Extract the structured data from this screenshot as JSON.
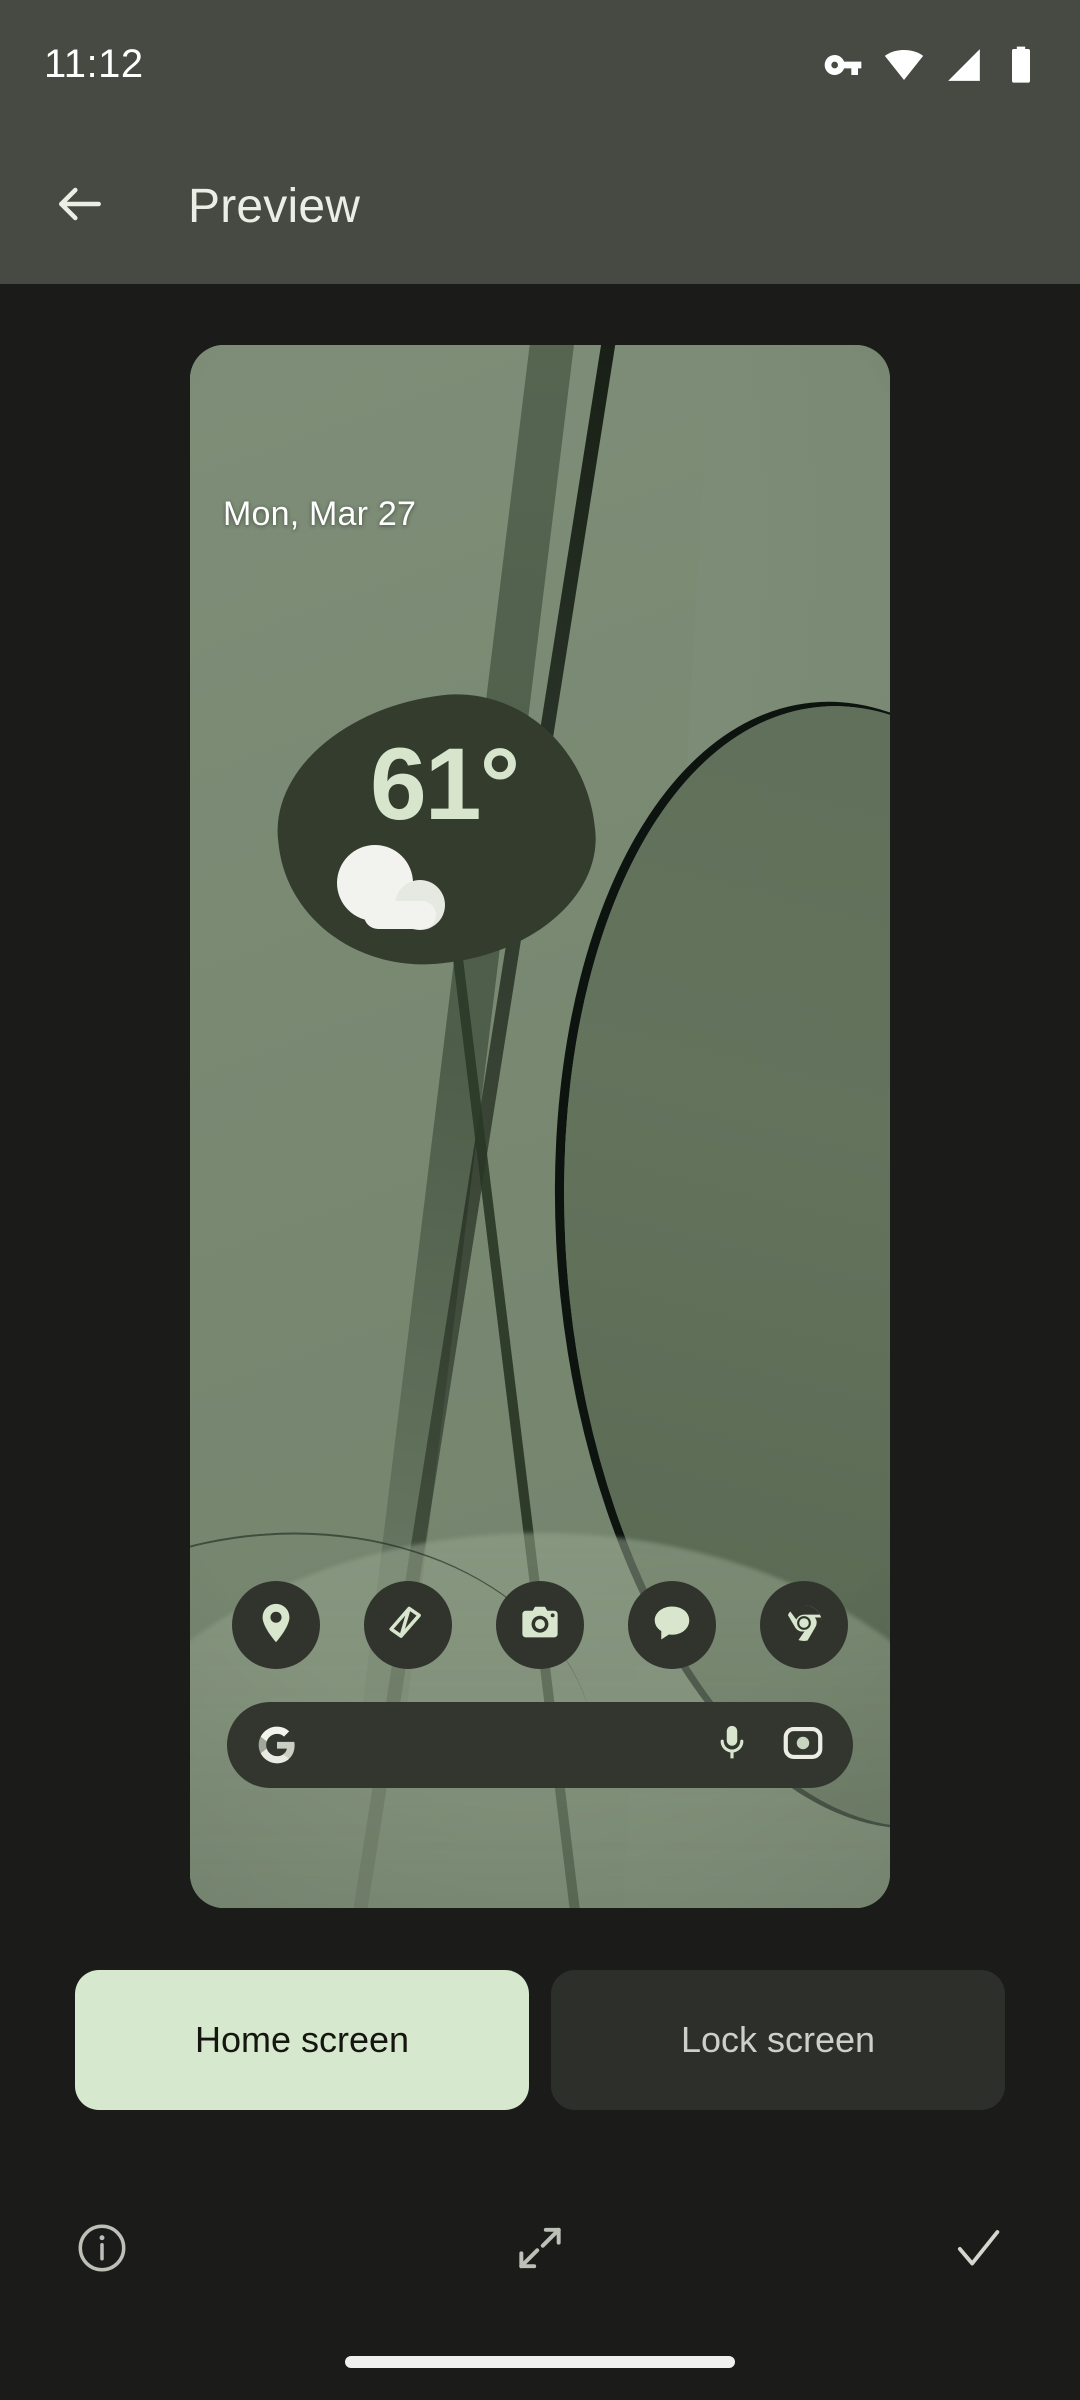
{
  "status_bar": {
    "time": "11:12",
    "icons": [
      "vpn-key-icon",
      "wifi-icon",
      "cellular-signal-icon",
      "battery-icon"
    ]
  },
  "app_bar": {
    "back_icon": "arrow-back-icon",
    "title": "Preview"
  },
  "preview": {
    "wallpaper_name": "abstract-green-leaves-wallpaper",
    "date": "Mon, Mar 27",
    "weather": {
      "temperature": "61°",
      "condition_icon": "cloud-icon"
    },
    "dock": [
      {
        "name": "maps",
        "icon": "maps-pin-icon"
      },
      {
        "name": "photos",
        "icon": "photos-icon"
      },
      {
        "name": "camera",
        "icon": "camera-icon"
      },
      {
        "name": "messages",
        "icon": "messages-icon"
      },
      {
        "name": "chrome",
        "icon": "chrome-icon"
      }
    ],
    "search": {
      "logo_icon": "google-g-icon",
      "mic_icon": "microphone-icon",
      "lens_icon": "google-lens-icon",
      "placeholder": ""
    }
  },
  "screen_toggle": {
    "options": [
      {
        "label": "Home screen",
        "selected": true
      },
      {
        "label": "Lock screen",
        "selected": false
      }
    ]
  },
  "bottom_toolbar": {
    "info_icon": "info-icon",
    "fullscreen_icon": "expand-fullscreen-icon",
    "apply_icon": "check-icon"
  },
  "navigation": {
    "gesture_bar": "home-gesture-bar"
  },
  "colors": {
    "status_bar_bg": "#474943",
    "page_bg": "#1b1c1a",
    "accent_selected": "#d6e8cd",
    "toggle_unselected": "#2d2f2b",
    "weather_blob": "#343c2e",
    "weather_text": "#d7e5cd",
    "wallpaper_green": "#7b8b76",
    "dock_icon_bg": "#31332d"
  }
}
